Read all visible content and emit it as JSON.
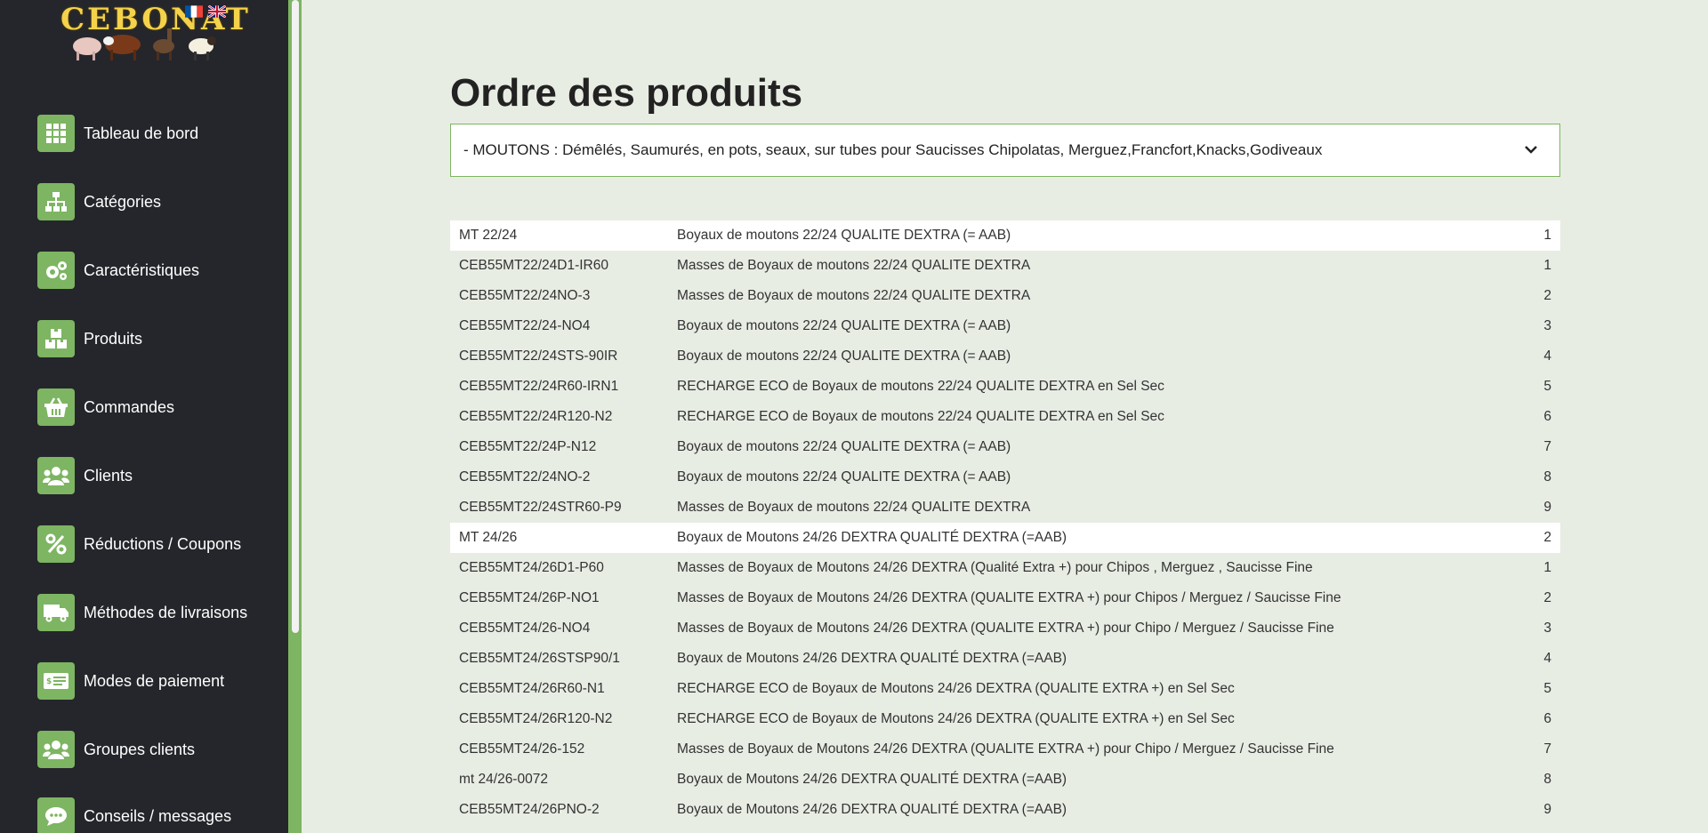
{
  "brand": {
    "logo_text": "CEBONAT"
  },
  "sidebar": {
    "items": [
      {
        "label": "Tableau de bord",
        "icon": "grid-icon"
      },
      {
        "label": "Catégories",
        "icon": "sitemap-icon"
      },
      {
        "label": "Caractéristiques",
        "icon": "gears-icon"
      },
      {
        "label": "Produits",
        "icon": "boxes-icon"
      },
      {
        "label": "Commandes",
        "icon": "basket-icon"
      },
      {
        "label": "Clients",
        "icon": "users-icon"
      },
      {
        "label": "Réductions / Coupons",
        "icon": "percent-icon"
      },
      {
        "label": "Méthodes de livraisons",
        "icon": "truck-icon"
      },
      {
        "label": "Modes de paiement",
        "icon": "money-check-icon"
      },
      {
        "label": "Groupes clients",
        "icon": "users-group-icon"
      },
      {
        "label": "Conseils / messages",
        "icon": "comment-icon"
      }
    ]
  },
  "main": {
    "title": "Ordre des produits",
    "category_select": {
      "selected": "- MOUTONS : Démêlés, Saumurés, en pots, seaux, sur tubes pour Saucisses Chipolatas, Merguez,Francfort,Knacks,Godiveaux"
    },
    "rows": [
      {
        "ref": "MT 22/24",
        "name": "Boyaux de moutons 22/24 QUALITE DEXTRA (= AAB)",
        "order": "1",
        "parent": true
      },
      {
        "ref": "CEB55MT22/24D1-IR60",
        "name": "Masses de Boyaux de moutons 22/24 QUALITE DEXTRA",
        "order": "1",
        "parent": false
      },
      {
        "ref": "CEB55MT22/24NO-3",
        "name": "Masses de Boyaux de moutons 22/24 QUALITE DEXTRA",
        "order": "2",
        "parent": false
      },
      {
        "ref": "CEB55MT22/24-NO4",
        "name": "Boyaux de moutons 22/24 QUALITE DEXTRA (= AAB)",
        "order": "3",
        "parent": false
      },
      {
        "ref": "CEB55MT22/24STS-90IR",
        "name": "Boyaux de moutons 22/24 QUALITE DEXTRA (= AAB)",
        "order": "4",
        "parent": false
      },
      {
        "ref": "CEB55MT22/24R60-IRN1",
        "name": "RECHARGE ECO de Boyaux de moutons 22/24 QUALITE DEXTRA en Sel Sec",
        "order": "5",
        "parent": false
      },
      {
        "ref": "CEB55MT22/24R120-N2",
        "name": "RECHARGE ECO de Boyaux de moutons 22/24 QUALITE DEXTRA en Sel Sec",
        "order": "6",
        "parent": false
      },
      {
        "ref": "CEB55MT22/24P-N12",
        "name": "Boyaux de moutons 22/24 QUALITE DEXTRA (= AAB)",
        "order": "7",
        "parent": false
      },
      {
        "ref": "CEB55MT22/24NO-2",
        "name": "Boyaux de moutons 22/24 QUALITE DEXTRA (= AAB)",
        "order": "8",
        "parent": false
      },
      {
        "ref": "CEB55MT22/24STR60-P9",
        "name": "Masses de Boyaux de moutons 22/24 QUALITE DEXTRA",
        "order": "9",
        "parent": false
      },
      {
        "ref": "MT 24/26",
        "name": "Boyaux de Moutons 24/26 DEXTRA QUALITÉ DEXTRA (=AAB)",
        "order": "2",
        "parent": true
      },
      {
        "ref": "CEB55MT24/26D1-P60",
        "name": "Masses de Boyaux de Moutons 24/26 DEXTRA (Qualité Extra +) pour Chipos , Merguez , Saucisse Fine",
        "order": "1",
        "parent": false
      },
      {
        "ref": "CEB55MT24/26P-NO1",
        "name": "Masses de Boyaux de Moutons 24/26 DEXTRA (QUALITE EXTRA +) pour Chipos / Merguez / Saucisse Fine",
        "order": "2",
        "parent": false
      },
      {
        "ref": "CEB55MT24/26-NO4",
        "name": "Masses de Boyaux de Moutons 24/26 DEXTRA (QUALITE EXTRA +) pour Chipo / Merguez / Saucisse Fine",
        "order": "3",
        "parent": false
      },
      {
        "ref": "CEB55MT24/26STSP90/1",
        "name": "Boyaux de Moutons 24/26 DEXTRA QUALITÉ DEXTRA (=AAB)",
        "order": "4",
        "parent": false
      },
      {
        "ref": "CEB55MT24/26R60-N1",
        "name": "RECHARGE ECO de Boyaux de Moutons 24/26 DEXTRA (QUALITE EXTRA +) en Sel Sec",
        "order": "5",
        "parent": false
      },
      {
        "ref": "CEB55MT24/26R120-N2",
        "name": "RECHARGE ECO de Boyaux de Moutons 24/26 DEXTRA (QUALITE EXTRA +) en Sel Sec",
        "order": "6",
        "parent": false
      },
      {
        "ref": "CEB55MT24/26-152",
        "name": "Masses de Boyaux de Moutons 24/26 DEXTRA (QUALITE EXTRA +) pour Chipo / Merguez / Saucisse Fine",
        "order": "7",
        "parent": false
      },
      {
        "ref": "mt 24/26-0072",
        "name": "Boyaux de Moutons 24/26 DEXTRA QUALITÉ DEXTRA (=AAB)",
        "order": "8",
        "parent": false
      },
      {
        "ref": "CEB55MT24/26PNO-2",
        "name": "Boyaux de Moutons 24/26 DEXTRA QUALITÉ DEXTRA (=AAB)",
        "order": "9",
        "parent": false
      }
    ]
  },
  "colors": {
    "sidebar_bg": "#25262b",
    "accent": "#7db562",
    "page_bg": "#e8ede4"
  }
}
